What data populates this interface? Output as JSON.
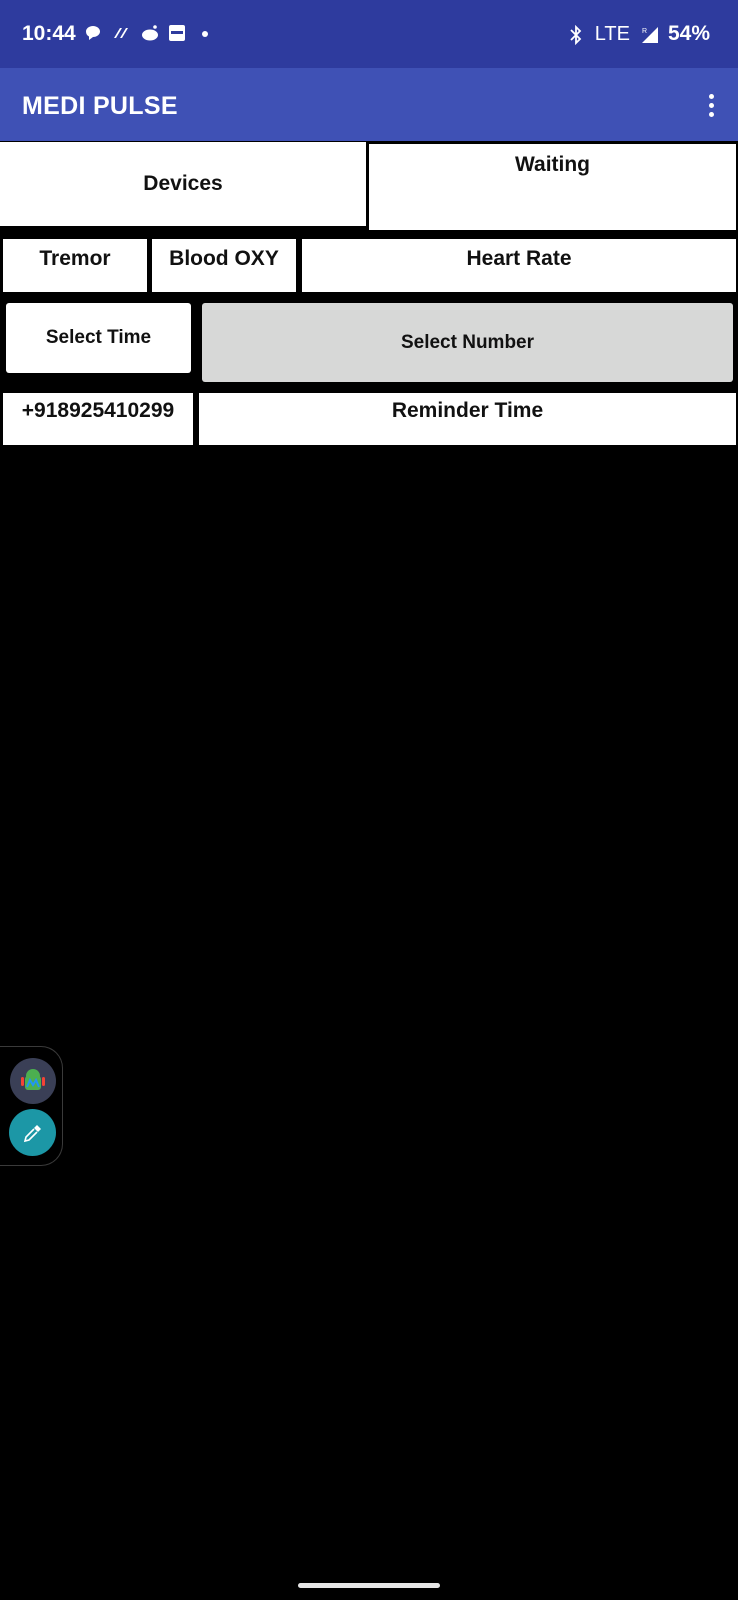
{
  "status_bar": {
    "time": "10:44",
    "network": "LTE",
    "battery": "54%",
    "icons": [
      "chat-bubble-icon",
      "app-logo-icon",
      "reddit-icon",
      "news-app-icon",
      "notification-dot-icon",
      "bluetooth-icon",
      "signal-icon"
    ]
  },
  "app_bar": {
    "title": "MEDI PULSE",
    "menu_icon": "overflow-menu-icon"
  },
  "row1": {
    "devices": "Devices",
    "waiting": "Waiting"
  },
  "row2": {
    "tremor": "Tremor",
    "blood_oxy": "Blood OXY",
    "heart_rate": "Heart Rate"
  },
  "row3": {
    "select_time": "Select Time",
    "select_number": "Select Number"
  },
  "row4": {
    "phone": "+918925410299",
    "reminder": "Reminder Time"
  },
  "floating_tools": {
    "icons": [
      "android-debug-icon",
      "color-picker-icon"
    ]
  },
  "colors": {
    "status_bar": "#2e3b9e",
    "app_bar": "#3f51b5",
    "background": "#000000",
    "button_grey": "#d7d8d7",
    "dropper_teal": "#1c97a6"
  }
}
